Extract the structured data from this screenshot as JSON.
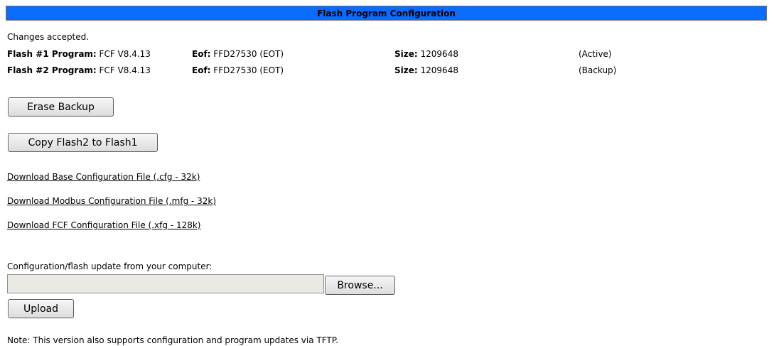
{
  "header": {
    "title": "Flash Program Configuration"
  },
  "status": {
    "message": "Changes accepted."
  },
  "flash_rows": [
    {
      "program_label": "Flash #1 Program:",
      "program_value": "FCF V8.4.13",
      "eof_label": "Eof:",
      "eof_value": "FFD27530 (EOT)",
      "size_label": "Size:",
      "size_value": "1209648",
      "state": "(Active)"
    },
    {
      "program_label": "Flash #2 Program:",
      "program_value": "FCF V8.4.13",
      "eof_label": "Eof:",
      "eof_value": "FFD27530 (EOT)",
      "size_label": "Size:",
      "size_value": "1209648",
      "state": "(Backup)"
    }
  ],
  "buttons": {
    "erase_backup": "Erase Backup",
    "copy_flash": "Copy Flash2 to Flash1",
    "browse": "Browse...",
    "upload": "Upload"
  },
  "downloads": [
    "Download Base Configuration File (.cfg - 32k)",
    "Download Modbus Configuration File (.mfg - 32k)",
    "Download FCF Configuration File (.xfg - 128k)"
  ],
  "update": {
    "label": "Configuration/flash update from your computer:",
    "file_value": ""
  },
  "note": "Note: This version also supports configuration and program updates via TFTP.",
  "colors": {
    "header_bg": "#0a6cff",
    "file_input_bg": "#ebe9e3"
  }
}
